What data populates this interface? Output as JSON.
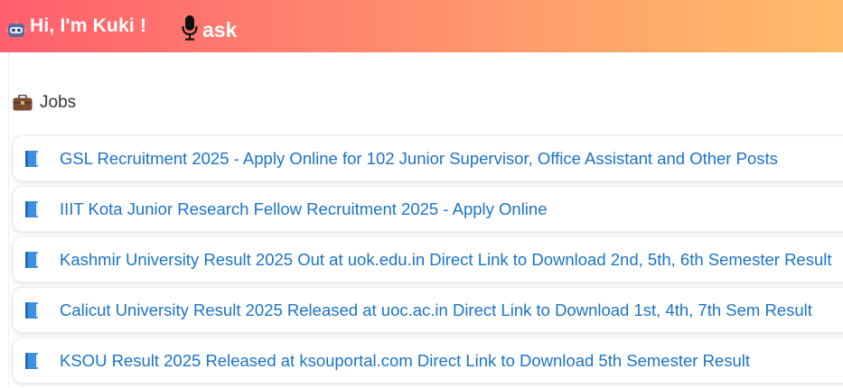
{
  "header": {
    "greeting": "Hi, I'm Kuki !",
    "ask_label": "ask",
    "bot_icon": "robot-icon",
    "mic_icon": "microphone-icon",
    "gradient_start": "#ff5f6d",
    "gradient_end": "#ffbb6a"
  },
  "section": {
    "icon": "briefcase-icon",
    "title": "Jobs"
  },
  "jobs": [
    {
      "icon": "book-icon",
      "title": "GSL Recruitment 2025 - Apply Online for 102 Junior Supervisor, Office Assistant and Other Posts"
    },
    {
      "icon": "book-icon",
      "title": "IIIT Kota Junior Research Fellow Recruitment 2025 - Apply Online"
    },
    {
      "icon": "book-icon",
      "title": "Kashmir University Result 2025 Out at uok.edu.in Direct Link to Download 2nd, 5th, 6th Semester Result"
    },
    {
      "icon": "book-icon",
      "title": "Calicut University Result 2025 Released at uoc.ac.in Direct Link to Download 1st, 4th, 7th Sem Result"
    },
    {
      "icon": "book-icon",
      "title": "KSOU Result 2025 Released at ksouportal.com Direct Link to Download 5th Semester Result"
    }
  ],
  "colors": {
    "link": "#1a73c7",
    "text": "#333333"
  }
}
